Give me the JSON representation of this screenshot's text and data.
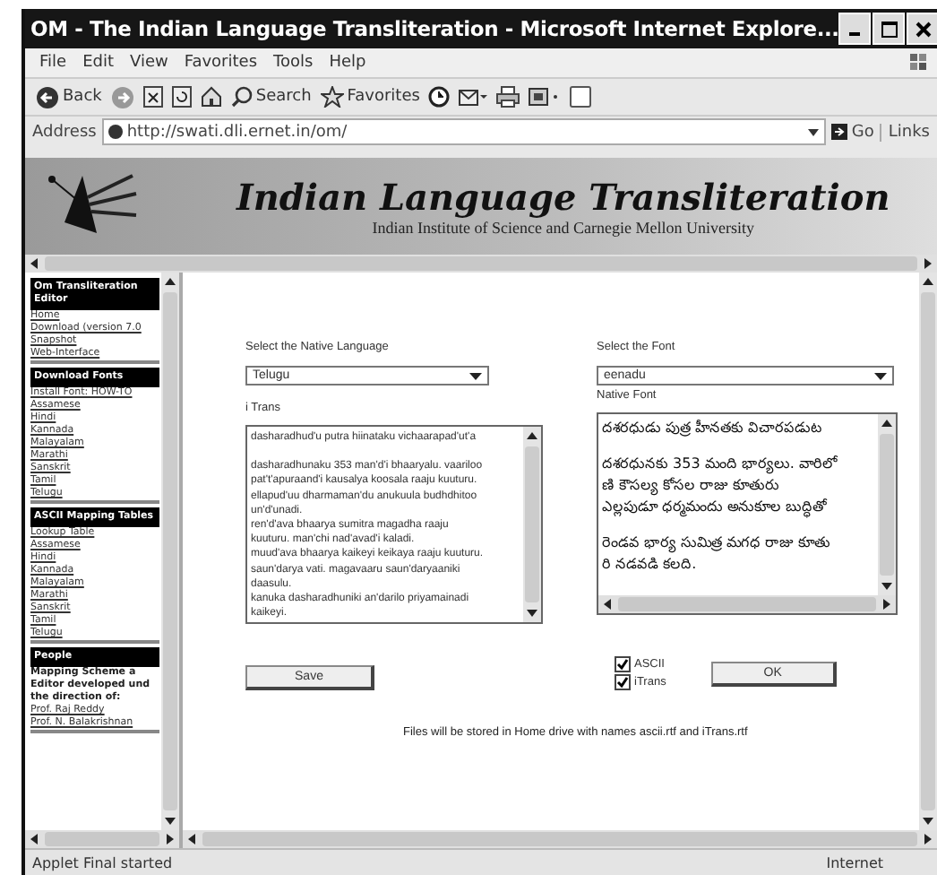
{
  "window": {
    "title": "OM - The Indian Language Transliteration - Microsoft Internet Explore..."
  },
  "menu": [
    "File",
    "Edit",
    "View",
    "Favorites",
    "Tools",
    "Help"
  ],
  "toolbar": [
    {
      "kind": "back",
      "label": "Back"
    },
    {
      "kind": "forward"
    },
    {
      "kind": "stop"
    },
    {
      "kind": "refresh"
    },
    {
      "kind": "home"
    },
    {
      "kind": "search",
      "label": "Search"
    },
    {
      "kind": "favorites",
      "label": "Favorites"
    },
    {
      "kind": "history"
    },
    {
      "kind": "mail"
    },
    {
      "kind": "print"
    },
    {
      "kind": "edit"
    },
    {
      "kind": "discuss"
    }
  ],
  "address": {
    "label": "Address",
    "value": "http://swati.dli.ernet.in/om/",
    "go": "Go",
    "links": "Links"
  },
  "banner": {
    "title": "Indian Language Transliteration",
    "subtitle": "Indian Institute of Science and Carnegie Mellon University"
  },
  "sidebar": [
    {
      "heading": "Om Transliteration Editor",
      "kind": "links",
      "items": [
        "Home",
        "Download (version 7.0",
        "Snapshot",
        "Web-Interface"
      ]
    },
    {
      "heading": "Download Fonts",
      "kind": "links",
      "items": [
        "Install Font: HOW-TO",
        "Assamese",
        "Hindi",
        "Kannada",
        "Malayalam",
        "Marathi",
        "Sanskrit",
        "Tamil",
        "Telugu"
      ]
    },
    {
      "heading": "ASCII Mapping Tables",
      "kind": "links",
      "items": [
        "Lookup Table",
        "Assamese",
        "Hindi",
        "Kannada",
        "Malayalam",
        "Marathi",
        "Sanskrit",
        "Tamil",
        "Telugu"
      ]
    },
    {
      "heading": "People",
      "kind": "text",
      "items": [
        "Mapping Scheme a",
        "Editor developed und",
        "the direction of:"
      ],
      "links": [
        "Prof. Raj Reddy",
        "Prof. N. Balakrishnan"
      ]
    }
  ],
  "form": {
    "language_label": "Select the Native Language",
    "language": "Telugu",
    "font_label": "Select the Font",
    "font": "eenadu",
    "itrans_label": "i Trans",
    "native_label": "Native Font",
    "itrans_lines": [
      {
        "text": "dasharadhud'u putra hiinataku vichaarapad'ut'a",
        "gap_before": false
      },
      {
        "text": "dasharadhunaku 353 man'd'i bhaaryalu. vaariloo",
        "gap_before": true
      },
      {
        "text": "pat't'apuraand'i kausalya koosala raaju kuuturu.",
        "gap_before": false
      },
      {
        "text": "ellapud'uu dharmaman'du anukuula budhdhitoo",
        "gap_before": false
      },
      {
        "text": "un'd'unadi.",
        "gap_before": false
      },
      {
        "text": "ren'd'ava bhaarya sumitra magadha raaju",
        "gap_before": false
      },
      {
        "text": "kuuturu. man'chi nad'avad'i kaladi.",
        "gap_before": false
      },
      {
        "text": "muud'ava bhaarya kaikeyi keikaya raaju kuuturu.",
        "gap_before": false
      },
      {
        "text": "saun'darya vati. magavaaru saun'daryaaniki",
        "gap_before": false
      },
      {
        "text": "daasulu.",
        "gap_before": false
      },
      {
        "text": "kanuka dasharadhuniki an'darilo priyamainadi",
        "gap_before": false
      },
      {
        "text": "kaikeyi.",
        "gap_before": false
      }
    ],
    "native_lines": [
      {
        "text": "దశరధుడు పుత్ర హీనతకు విచారపడుట",
        "gap_before": false
      },
      {
        "text": "దశరధునకు 353 మంది భార్యలు. వారిలో",
        "gap_before": true
      },
      {
        "text": "ణి కౌసల్య కోసల రాజు కూతురు",
        "gap_before": false
      },
      {
        "text": "ఎల్లపుడూ ధర్మమందు అనుకూల బుద్ధితో",
        "gap_before": false
      },
      {
        "text": "రెండవ భార్య సుమిత్ర మగధ రాజు కూతు",
        "gap_before": true
      },
      {
        "text": "రి నడవడి కలది.",
        "gap_before": false
      }
    ],
    "save": "Save",
    "ok": "OK",
    "options": [
      {
        "label": "ASCII",
        "checked": true
      },
      {
        "label": "iTrans",
        "checked": true
      }
    ],
    "note": "Files will be stored in Home drive with names ascii.rtf and iTrans.rtf"
  },
  "status_bar": {
    "text": "Applet Final started",
    "zone": "Internet"
  }
}
